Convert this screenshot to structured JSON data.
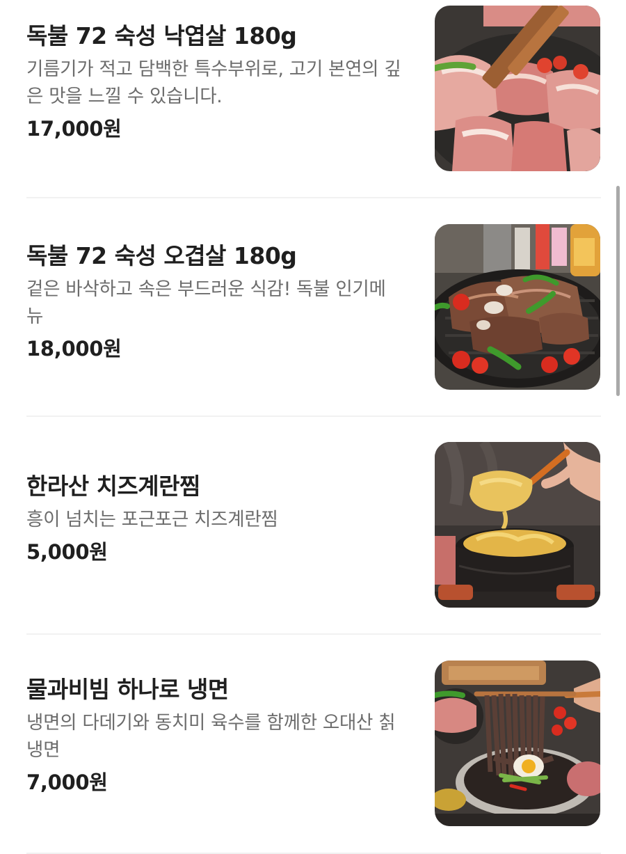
{
  "menu": {
    "items": [
      {
        "name": "독불 72 숙성 낙엽살 180g",
        "description": "기름기가 적고 담백한 특수부위로, 고기 본연의 깊은 맛을 느낄 수 있습니다.",
        "price": "17,000원",
        "photo_icon": "grilled-pork-photo"
      },
      {
        "name": "독불 72 숙성 오겹살 180g",
        "description": "겉은 바삭하고 속은 부드러운 식감! 독불 인기메뉴",
        "price": "18,000원",
        "photo_icon": "pork-belly-grill-photo"
      },
      {
        "name": "한라산 치즈계란찜",
        "description": "흥이 넘치는 포근포근 치즈계란찜",
        "price": "5,000원",
        "photo_icon": "steamed-egg-photo"
      },
      {
        "name": "물과비빔 하나로 냉면",
        "description": "냉면의 다데기와 동치미 육수를 함께한 오대산 칡냉면",
        "price": "7,000원",
        "photo_icon": "cold-noodles-photo"
      }
    ]
  }
}
